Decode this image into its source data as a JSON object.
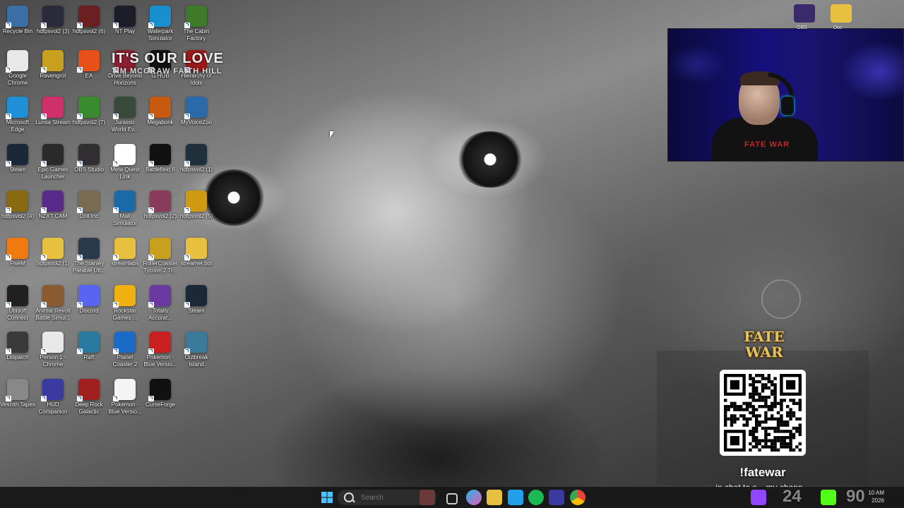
{
  "desktop": {
    "icons": [
      {
        "label": "Recycle Bin",
        "icon": "recycle-bin-icon",
        "color": "#3a6ea5"
      },
      {
        "label": "hdfpsvol2 (3)",
        "icon": "app-icon",
        "color": "#2a2a3a"
      },
      {
        "label": "hdfpsvol2 (6)",
        "icon": "app-icon",
        "color": "#6a2020"
      },
      {
        "label": "NT Play",
        "icon": "nt-play-icon",
        "color": "#1d1d2a"
      },
      {
        "label": "Waterpark Simulator",
        "icon": "waterpark-icon",
        "color": "#1a8fd0"
      },
      {
        "label": "The Cabin Factory",
        "icon": "frog-icon",
        "color": "#3d7a2a"
      },
      {
        "label": "Google Chrome",
        "icon": "chrome-icon",
        "color": "#e8e8e8"
      },
      {
        "label": "Ravengrot",
        "icon": "app-icon",
        "color": "#c8a020"
      },
      {
        "label": "EA",
        "icon": "ea-icon",
        "color": "#e8501a"
      },
      {
        "label": "Drive Beyond Horizons",
        "icon": "app-icon",
        "color": "#8a2030"
      },
      {
        "label": "G HUB",
        "icon": "logitech-g-icon",
        "color": "#111111"
      },
      {
        "label": "Hierarchy of Idols",
        "icon": "app-icon",
        "color": "#9a1a1a"
      },
      {
        "label": "Microsoft Edge",
        "icon": "edge-icon",
        "color": "#1f8fd8"
      },
      {
        "label": "Lumia Stream",
        "icon": "lumia-icon",
        "color": "#d0306a"
      },
      {
        "label": "hdfpsvol2 (7)",
        "icon": "app-icon",
        "color": "#3a8a30"
      },
      {
        "label": "Jurassic World Ev...",
        "icon": "jurassic-icon",
        "color": "#3a4a3a"
      },
      {
        "label": "Megabonk",
        "icon": "megabonk-icon",
        "color": "#c85a10"
      },
      {
        "label": "MyVoiceZoo",
        "icon": "penguin-icon",
        "color": "#2a6aa8"
      },
      {
        "label": "Steam",
        "icon": "steam-icon",
        "color": "#1b2838"
      },
      {
        "label": "Epic Games Launcher",
        "icon": "epic-icon",
        "color": "#2a2a2a"
      },
      {
        "label": "OBS Studio",
        "icon": "obs-icon",
        "color": "#302e31"
      },
      {
        "label": "Meta Quest Link",
        "icon": "meta-icon",
        "color": "#ffffff"
      },
      {
        "label": "Battlefield 6",
        "icon": "bf-icon",
        "color": "#111111"
      },
      {
        "label": "hdfpsvol2 (1)",
        "icon": "app-icon",
        "color": "#20303a"
      },
      {
        "label": "hdfpsvol2 (4)",
        "icon": "app-icon",
        "color": "#8a6a10"
      },
      {
        "label": "NZXT CAM",
        "icon": "nzxt-icon",
        "color": "#5a2a8a"
      },
      {
        "label": "Doll Inc",
        "icon": "doll-icon",
        "color": "#7a6a50"
      },
      {
        "label": "Mall Simulator",
        "icon": "mall-icon",
        "color": "#1a6aa8"
      },
      {
        "label": "hdfpsvol2 (2)",
        "icon": "app-icon",
        "color": "#8a3a5a"
      },
      {
        "label": "hdfpsvol2 (5)",
        "icon": "app-icon",
        "color": "#d09a10"
      },
      {
        "label": "FiveM",
        "icon": "fivem-icon",
        "color": "#f07a10"
      },
      {
        "label": "hdfpsvol2 (1)",
        "icon": "folder-icon",
        "color": "#e8c040"
      },
      {
        "label": "The Stanley Parable Ult...",
        "icon": "stanley-icon",
        "color": "#2a3a4a"
      },
      {
        "label": "streamlabs",
        "icon": "folder-icon",
        "color": "#e8c040"
      },
      {
        "label": "RollerCoaster Tycoon 2 Tr...",
        "icon": "rct-icon",
        "color": "#c8a020"
      },
      {
        "label": "streamer.bot",
        "icon": "folder-icon",
        "color": "#e8c040"
      },
      {
        "label": "Ubisoft Connect",
        "icon": "ubisoft-icon",
        "color": "#202020"
      },
      {
        "label": "Animal Revolt Battle Simul...",
        "icon": "app-icon",
        "color": "#8a5a30"
      },
      {
        "label": "Discord",
        "icon": "discord-icon",
        "color": "#5865f2"
      },
      {
        "label": "Rockstar Games ...",
        "icon": "rockstar-icon",
        "color": "#f0b010"
      },
      {
        "label": "Totally Accurat...",
        "icon": "tabs-icon",
        "color": "#6a3aa0"
      },
      {
        "label": "Steam",
        "icon": "steam-icon",
        "color": "#1b2838"
      },
      {
        "label": "Dispatch",
        "icon": "dispatch-icon",
        "color": "#3a3a3a"
      },
      {
        "label": "Person 1 - Chrome",
        "icon": "chrome-icon",
        "color": "#e8e8e8"
      },
      {
        "label": "Raft",
        "icon": "raft-icon",
        "color": "#2a7aa0"
      },
      {
        "label": "Planet Coaster 2",
        "icon": "planet-coaster-icon",
        "color": "#1a6ac8"
      },
      {
        "label": "Pokemon - Blue Versio...",
        "icon": "apex-icon",
        "color": "#c82020"
      },
      {
        "label": "Outbreak Island",
        "icon": "outbreak-icon",
        "color": "#3a7a9a"
      },
      {
        "label": "Vesnith Tapes",
        "icon": "tape-icon",
        "color": "#888888"
      },
      {
        "label": "HUD Companion",
        "icon": "hud-icon",
        "color": "#3a3aa0"
      },
      {
        "label": "Deep Rock Galactic",
        "icon": "drg-icon",
        "color": "#a02020"
      },
      {
        "label": "Pokemon - Blue Versio...",
        "icon": "file-icon",
        "color": "#f4f4f4"
      },
      {
        "label": "CurseForge",
        "icon": "curseforge-icon",
        "color": "#111111"
      }
    ]
  },
  "overlay": {
    "line1": "IT'S OUR LOVE",
    "line2": "TIM MCGRAW FAITH HILL"
  },
  "webcam": {
    "shirt_text": "FATE WAR"
  },
  "tray_top": {
    "labels": [
      "OBS",
      "Doc"
    ]
  },
  "fatewar": {
    "logo_line1": "FATE",
    "logo_line2": "WAR",
    "command": "!fatewar",
    "subtitle": "in chat to s... my chann..."
  },
  "taskbar": {
    "search_placeholder": "Search",
    "viewer_count_purple": "24",
    "viewer_count_green": "90",
    "clock_time": "10 AM",
    "clock_date": "2026"
  },
  "colors": {
    "taskbar_bg": "#181818",
    "twitch_purple": "#9146ff",
    "kick_green": "#53fc18",
    "windows_blue": "#0078d4"
  }
}
